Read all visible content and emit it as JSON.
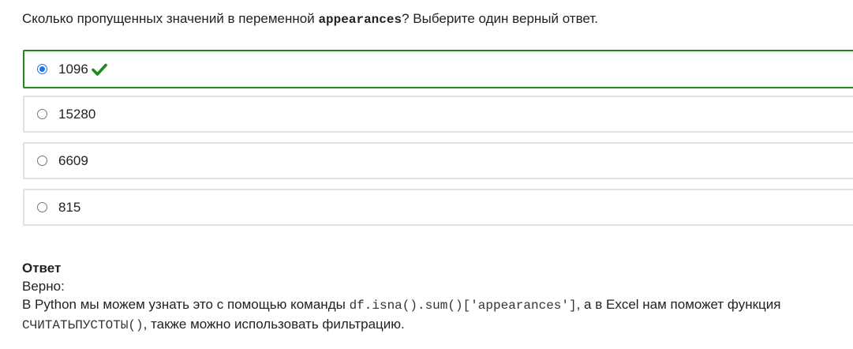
{
  "question": {
    "prefix": "Сколько пропущенных значений в переменной ",
    "variable": "appearances",
    "suffix": "? Выберите один верный ответ."
  },
  "options": [
    {
      "label": "1096",
      "selected": true,
      "correct": true
    },
    {
      "label": "15280",
      "selected": false
    },
    {
      "label": "6609",
      "selected": false
    },
    {
      "label": "815",
      "selected": false
    }
  ],
  "answer": {
    "heading": "Ответ",
    "verdict": "Верно:",
    "text_1": "В Python мы можем узнать это с помощью команды ",
    "code_1": "df.isna().sum()['appearances']",
    "text_2": ", а в Excel нам поможет функция ",
    "code_2": "СЧИТАТЬПУСТОТЫ()",
    "text_3": ", также можно использовать фильтрацию."
  },
  "colors": {
    "correct_border": "#1f8a1f",
    "radio_selected": "#1a73e8",
    "option_border": "#e1e1e1"
  },
  "icons": {
    "correct_mark": "checkmark-icon"
  }
}
